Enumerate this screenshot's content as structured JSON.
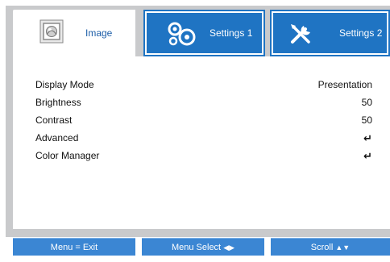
{
  "tabs": [
    {
      "label": "Image",
      "icon": "image-icon",
      "active": true
    },
    {
      "label": "Settings 1",
      "icon": "gears-icon",
      "active": false
    },
    {
      "label": "Settings 2",
      "icon": "tools-icon",
      "active": false
    }
  ],
  "menu": {
    "rows": [
      {
        "label": "Display Mode",
        "value": "Presentation"
      },
      {
        "label": "Brightness",
        "value": "50"
      },
      {
        "label": "Contrast",
        "value": "50"
      },
      {
        "label": "Advanced",
        "value": "↵"
      },
      {
        "label": "Color Manager",
        "value": "↵"
      }
    ]
  },
  "footer": {
    "exit": "Menu = Exit",
    "select": "Menu Select",
    "select_arrows": "◀▶",
    "scroll": "Scroll",
    "scroll_arrows": "▲▼"
  },
  "colors": {
    "accent": "#1f74c3",
    "footer": "#3b86d3",
    "frame": "#c9cacc"
  }
}
